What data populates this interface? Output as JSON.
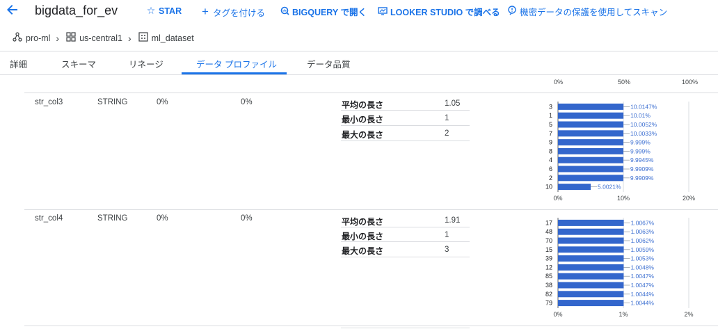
{
  "header": {
    "title": "bigdata_for_ev",
    "actions": [
      {
        "icon": "star-icon",
        "label": "STAR"
      },
      {
        "icon": "plus-icon",
        "label": "タグを付ける"
      },
      {
        "icon": "bigquery-icon",
        "label": "BIGQUERY で開く"
      },
      {
        "icon": "looker-icon",
        "label": "LOOKER STUDIO で調べる"
      },
      {
        "icon": "dlp-icon",
        "label": "機密データの保護を使用してスキャン"
      }
    ]
  },
  "breadcrumb": [
    {
      "icon": "project-icon",
      "label": "pro-ml"
    },
    {
      "icon": "region-icon",
      "label": "us-central1"
    },
    {
      "icon": "dataset-icon",
      "label": "ml_dataset"
    }
  ],
  "tabs": [
    "詳細",
    "スキーマ",
    "リネージ",
    "データ プロファイル",
    "データ品質"
  ],
  "active_tab": "データ プロファイル",
  "top_axis": [
    "0%",
    "50%",
    "100%"
  ],
  "rows": [
    {
      "name": "str_col3",
      "type": "STRING",
      "null_pct": "0%",
      "unique_pct": "0%",
      "stats": [
        {
          "label": "平均の長さ",
          "value": "1.05"
        },
        {
          "label": "最小の長さ",
          "value": "1"
        },
        {
          "label": "最大の長さ",
          "value": "2"
        }
      ]
    },
    {
      "name": "str_col4",
      "type": "STRING",
      "null_pct": "0%",
      "unique_pct": "0%",
      "stats": [
        {
          "label": "平均の長さ",
          "value": "1.91"
        },
        {
          "label": "最小の長さ",
          "value": "1"
        },
        {
          "label": "最大の長さ",
          "value": "3"
        }
      ]
    }
  ],
  "chart_data": [
    {
      "type": "bar",
      "orientation": "horizontal",
      "categories": [
        "3",
        "1",
        "5",
        "7",
        "9",
        "8",
        "4",
        "6",
        "2",
        "10"
      ],
      "values": [
        10.0147,
        10.01,
        10.0052,
        10.0033,
        9.999,
        9.999,
        9.9945,
        9.9909,
        9.9909,
        5.0021
      ],
      "data_labels": [
        "10.0147%",
        "10.01%",
        "10.0052%",
        "10.0033%",
        "9.999%",
        "9.999%",
        "9.9945%",
        "9.9909%",
        "9.9909%",
        "5.0021%"
      ],
      "x_ticks": [
        "0%",
        "10%",
        "20%"
      ],
      "xlim": [
        0,
        20
      ],
      "bar_color": "#3366cc",
      "grid": true
    },
    {
      "type": "bar",
      "orientation": "horizontal",
      "categories": [
        "17",
        "48",
        "70",
        "15",
        "39",
        "12",
        "85",
        "38",
        "82",
        "79"
      ],
      "values": [
        1.0067,
        1.0063,
        1.0062,
        1.0059,
        1.0053,
        1.0048,
        1.0047,
        1.0047,
        1.0044,
        1.0044
      ],
      "data_labels": [
        "1.0067%",
        "1.0063%",
        "1.0062%",
        "1.0059%",
        "1.0053%",
        "1.0048%",
        "1.0047%",
        "1.0047%",
        "1.0044%",
        "1.0044%"
      ],
      "x_ticks": [
        "0%",
        "1%",
        "2%"
      ],
      "xlim": [
        0,
        2
      ],
      "bar_color": "#3366cc",
      "grid": true
    }
  ]
}
